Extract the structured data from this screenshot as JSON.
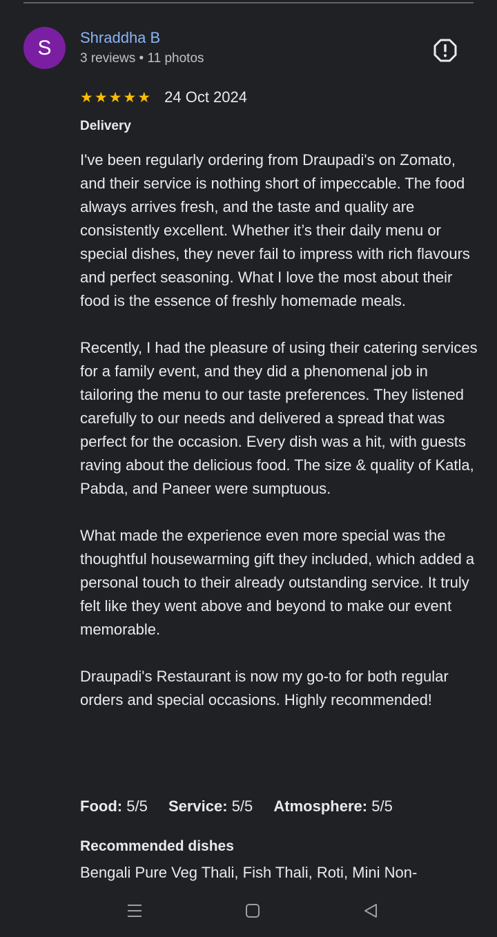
{
  "reviewer": {
    "initial": "S",
    "name": "Shraddha B",
    "meta": "3 reviews • 11 photos",
    "avatar_color": "#7b1fa2"
  },
  "report_icon": "exclamation-circle-icon",
  "review": {
    "rating": 5,
    "rating_max": 5,
    "date": "24 Oct 2024",
    "service_type": "Delivery",
    "paragraphs": [
      "I've been regularly ordering from Draupadi's on Zomato, and their service is nothing short of impeccable. The food always arrives fresh, and the taste and quality are consistently excellent. Whether it’s their daily menu or special dishes, they never fail to impress with rich flavours and perfect seasoning. What I love the most about their food is the essence of freshly homemade meals.",
      "Recently, I had the pleasure of using their catering services for a family event, and they did a phenomenal job in tailoring the menu to our taste preferences. They listened carefully to our needs and delivered a spread that was perfect for the occasion. Every dish was a hit, with guests raving about the delicious food. The size & quality of Katla, Pabda, and Paneer were sumptuous.",
      "What made the experience even more special was the thoughtful housewarming gift they included, which added a personal touch to their already outstanding service. It truly felt like they went above and beyond to make our event memorable.",
      "Draupadi's Restaurant is now my go-to for both regular orders and special occasions. Highly recommended!"
    ],
    "sub_ratings": [
      {
        "label": "Food:",
        "value": "5/5"
      },
      {
        "label": "Service:",
        "value": "5/5"
      },
      {
        "label": "Atmosphere:",
        "value": "5/5"
      }
    ],
    "recommended_heading": "Recommended dishes",
    "recommended_dishes": "Bengali Pure Veg Thali, Fish Thali, Roti, Mini Non-"
  },
  "colors": {
    "background": "#202124",
    "name_link": "#8ab4f8",
    "star": "#fbbc04",
    "text": "#e8eaed",
    "secondary_text": "#bdc1c6"
  },
  "nav_bar": {
    "icons": [
      "menu-lines-icon",
      "square-home-icon",
      "triangle-back-icon"
    ]
  }
}
